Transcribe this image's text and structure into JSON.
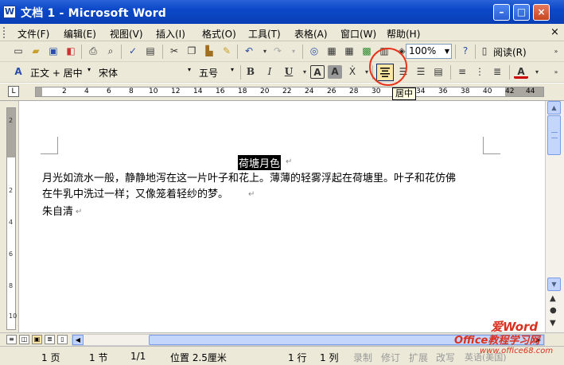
{
  "window": {
    "title": "文档 1 - Microsoft Word",
    "app_icon": "word-doc-icon",
    "controls": [
      "minimize",
      "maximize",
      "close"
    ]
  },
  "menubar": {
    "items": [
      {
        "label": "文件(F)"
      },
      {
        "label": "编辑(E)"
      },
      {
        "label": "视图(V)"
      },
      {
        "label": "插入(I)"
      },
      {
        "label": "格式(O)"
      },
      {
        "label": "工具(T)"
      },
      {
        "label": "表格(A)"
      },
      {
        "label": "窗口(W)"
      },
      {
        "label": "帮助(H)"
      }
    ],
    "close_doc": "×"
  },
  "standard_toolbar": {
    "zoom": "100%",
    "reading_label": "阅读(R)"
  },
  "format_toolbar": {
    "style": "正文 + 居中",
    "font": "宋体",
    "size": "五号",
    "bold": "B",
    "italic": "I",
    "underline": "U",
    "char_border": "A",
    "char_shade": "A",
    "tooltip": "居中",
    "font_color": "A"
  },
  "ruler": {
    "ticks": [
      "2",
      "4",
      "6",
      "8",
      "10",
      "12",
      "14",
      "16",
      "18",
      "20",
      "22",
      "24",
      "26",
      "28",
      "30",
      "32",
      "34",
      "36",
      "38",
      "40",
      "42",
      "44"
    ],
    "corner": "L"
  },
  "vruler": {
    "ticks": [
      "2",
      "2",
      "4",
      "6",
      "8",
      "10"
    ]
  },
  "document": {
    "title": "荷塘月色",
    "paragraph_1": "月光如流水一般，静静地泻在这一片叶子和花上。薄薄的轻雾浮起在荷塘里。叶子和花仿佛",
    "paragraph_2": "在牛乳中洗过一样；又像笼着轻纱的梦。",
    "author": "朱自清",
    "para_mark": "↵"
  },
  "statusbar": {
    "page": "1 页",
    "section": "1 节",
    "page_of": "1/1",
    "position": "位置 2.5厘米",
    "line": "1 行",
    "column": "1 列",
    "rec": "录制",
    "trk": "修订",
    "ext": "扩展",
    "ovr": "改写",
    "lang": "英语(美国)"
  },
  "watermark": {
    "line1": "爱Word",
    "line2": "Office教程学习网",
    "line3": "www.office68.com"
  }
}
